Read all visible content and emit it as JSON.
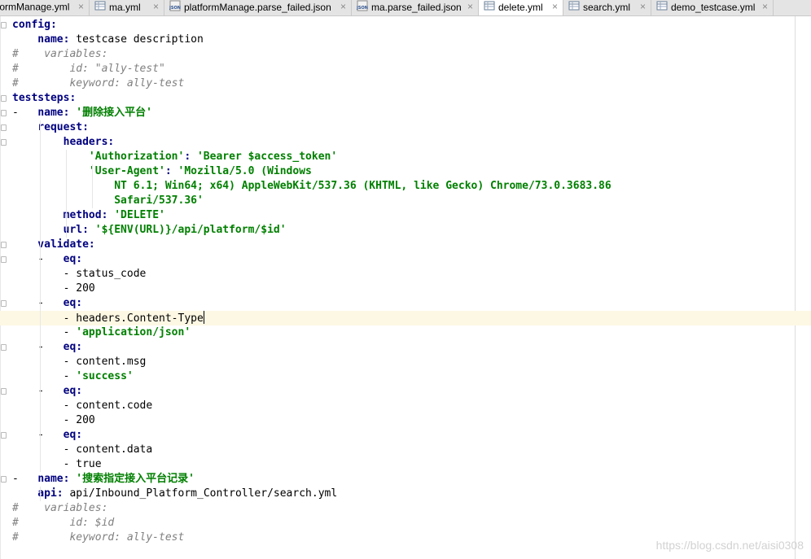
{
  "tabs": [
    {
      "label": "formManage.yml",
      "icon": "yaml-file-icon",
      "active": false
    },
    {
      "label": "ma.yml",
      "icon": "yaml-file-icon",
      "active": false
    },
    {
      "label": "platformManage.parse_failed.json",
      "icon": "json-file-icon",
      "active": false
    },
    {
      "label": "ma.parse_failed.json",
      "icon": "json-file-icon",
      "active": false
    },
    {
      "label": "delete.yml",
      "icon": "yaml-file-icon",
      "active": true
    },
    {
      "label": "search.yml",
      "icon": "yaml-file-icon",
      "active": false
    },
    {
      "label": "demo_testcase.yml",
      "icon": "yaml-file-icon",
      "active": false
    }
  ],
  "json_icon_text": "JSON",
  "close_symbol": "×",
  "editor": {
    "current_line": 21,
    "lines": [
      [
        [
          "config:",
          "key"
        ]
      ],
      [
        [
          "    name: ",
          "key"
        ],
        [
          "testcase description",
          "plain"
        ]
      ],
      [
        [
          "#    variables:",
          "comment"
        ]
      ],
      [
        [
          "#        id: \"ally-test\"",
          "comment"
        ]
      ],
      [
        [
          "#        keyword: ally-test",
          "comment"
        ]
      ],
      [
        [
          "teststeps:",
          "key"
        ]
      ],
      [
        [
          "-   ",
          "plain"
        ],
        [
          "name: ",
          "key"
        ],
        [
          "'删除接入平台'",
          "str"
        ]
      ],
      [
        [
          "    request:",
          "key"
        ]
      ],
      [
        [
          "        headers:",
          "key"
        ]
      ],
      [
        [
          "            ",
          "plain"
        ],
        [
          "'Authorization'",
          "str"
        ],
        [
          ": ",
          "key"
        ],
        [
          "'Bearer $access_token'",
          "str"
        ]
      ],
      [
        [
          "            ",
          "plain"
        ],
        [
          "'User-Agent'",
          "str"
        ],
        [
          ": ",
          "key"
        ],
        [
          "'Mozilla/5.0 (Windows",
          "str"
        ]
      ],
      [
        [
          "                NT 6.1; Win64; x64) AppleWebKit/537.36 (KHTML, like Gecko) Chrome/73.0.3683.86",
          "str"
        ]
      ],
      [
        [
          "                Safari/537.36'",
          "str"
        ]
      ],
      [
        [
          "        method: ",
          "key"
        ],
        [
          "'DELETE'",
          "str"
        ]
      ],
      [
        [
          "        url: ",
          "key"
        ],
        [
          "'${ENV(URL)}/api/platform/$id'",
          "str"
        ]
      ],
      [
        [
          "    validate:",
          "key"
        ]
      ],
      [
        [
          "    -   ",
          "plain"
        ],
        [
          "eq:",
          "key"
        ]
      ],
      [
        [
          "        - status_code",
          "plain"
        ]
      ],
      [
        [
          "        - 200",
          "plain"
        ]
      ],
      [
        [
          "    -   ",
          "plain"
        ],
        [
          "eq:",
          "key"
        ]
      ],
      [
        [
          "        - headers.Content-Type",
          "plain"
        ]
      ],
      [
        [
          "        - ",
          "plain"
        ],
        [
          "'application/json'",
          "str"
        ]
      ],
      [
        [
          "    -   ",
          "plain"
        ],
        [
          "eq:",
          "key"
        ]
      ],
      [
        [
          "        - content.msg",
          "plain"
        ]
      ],
      [
        [
          "        - ",
          "plain"
        ],
        [
          "'success'",
          "str"
        ]
      ],
      [
        [
          "    -   ",
          "plain"
        ],
        [
          "eq:",
          "key"
        ]
      ],
      [
        [
          "        - content.code",
          "plain"
        ]
      ],
      [
        [
          "        - 200",
          "plain"
        ]
      ],
      [
        [
          "    -   ",
          "plain"
        ],
        [
          "eq:",
          "key"
        ]
      ],
      [
        [
          "        - content.data",
          "plain"
        ]
      ],
      [
        [
          "        - true",
          "plain"
        ]
      ],
      [
        [
          "-   ",
          "plain"
        ],
        [
          "name: ",
          "key"
        ],
        [
          "'搜索指定接入平台记录'",
          "str"
        ]
      ],
      [
        [
          "    api: ",
          "key"
        ],
        [
          "api/Inbound_Platform_Controller/search.yml",
          "plain"
        ]
      ],
      [
        [
          "#    variables:",
          "comment"
        ]
      ],
      [
        [
          "#        id: $id",
          "comment"
        ]
      ],
      [
        [
          "#        keyword: ally-test",
          "comment"
        ]
      ]
    ]
  },
  "watermark": "https://blog.csdn.net/aisi0308"
}
